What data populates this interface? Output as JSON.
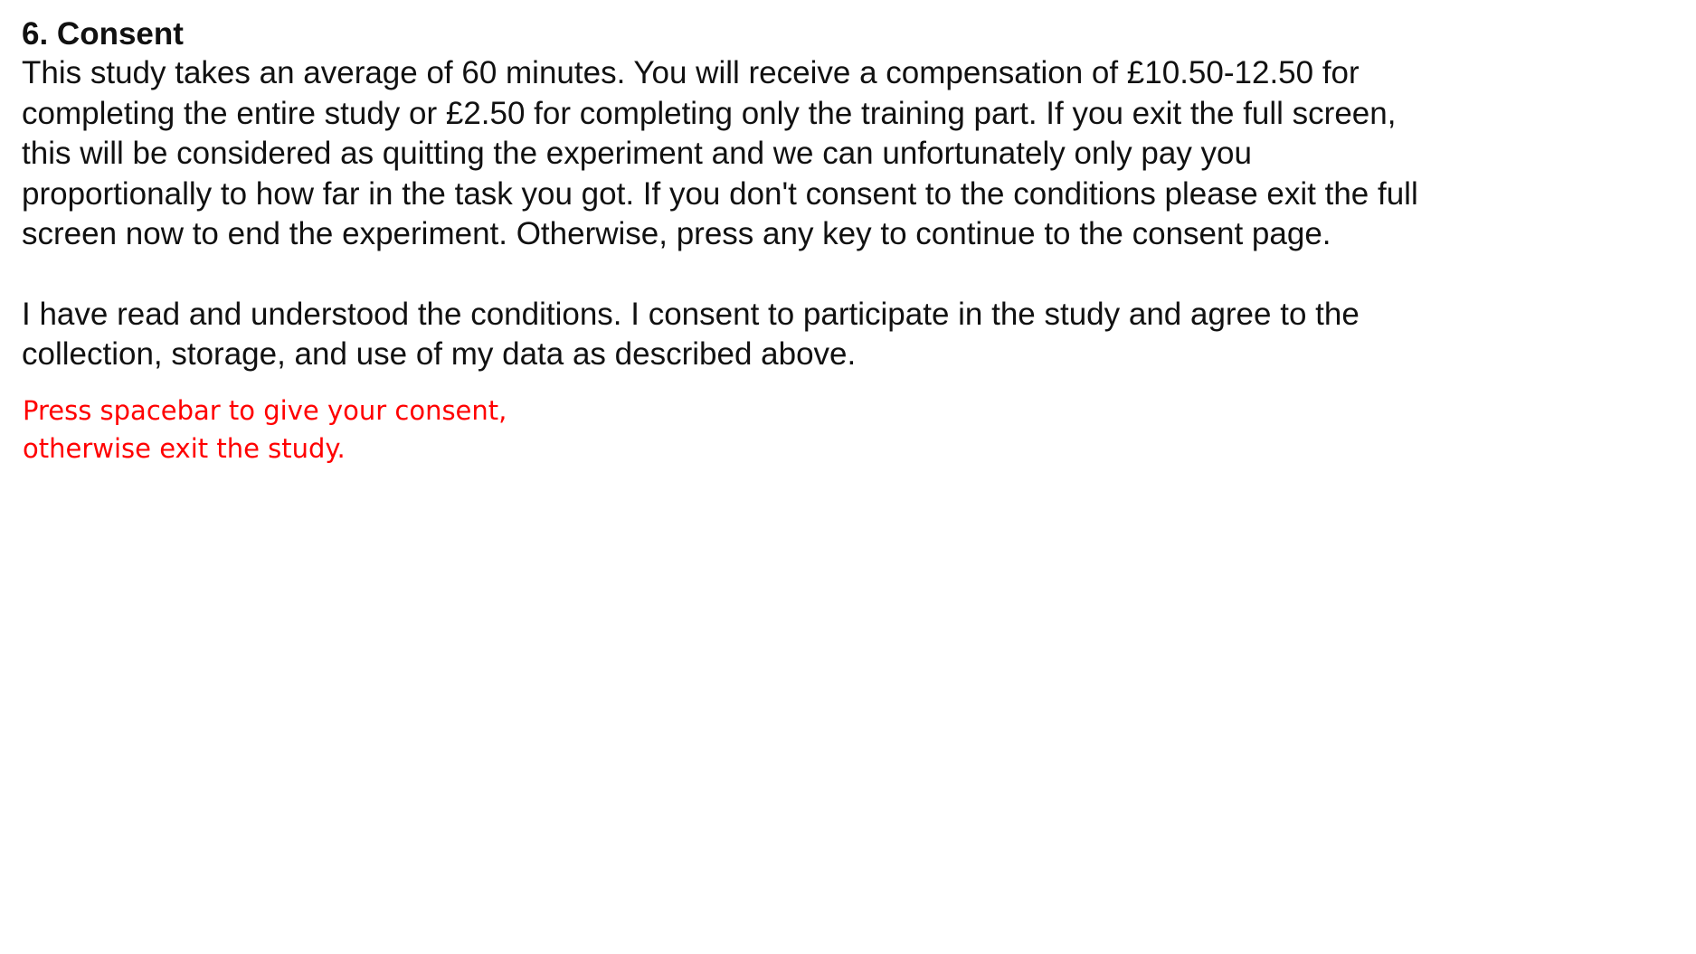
{
  "section": {
    "title": "6. Consent"
  },
  "conditions": {
    "text": "This study takes an average of 60 minutes. You will receive a compensation of £10.50-12.50 for completing the entire study or £2.50 for completing only the training part. If you exit the full screen, this will be considered as quitting the experiment and we can unfortunately only pay you proportionally to how far in the task you got. If you don't consent to the conditions please exit the full screen now to end the experiment. Otherwise, press any key to continue to the consent page."
  },
  "consent_statement": {
    "text": "I have read and understood the conditions. I consent to participate in the study and agree to the collection, storage, and use of my data as described above."
  },
  "instruction": {
    "line1": "Press spacebar to give your consent,",
    "line2": "otherwise exit the study.",
    "color": "#ff0000"
  }
}
